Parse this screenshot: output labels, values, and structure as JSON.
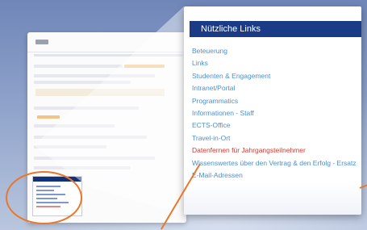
{
  "zoom_panel": {
    "title": "Nützliche Links",
    "links": [
      {
        "label": "Beteuerung"
      },
      {
        "label": "Links"
      },
      {
        "label": "Studenten & Engagement"
      },
      {
        "label": "Intranet/Portal"
      },
      {
        "label": "Programmatics"
      },
      {
        "label": "Informationen - Staff"
      },
      {
        "label": "ECTS-Office"
      },
      {
        "label": "Travel-in-Ort"
      },
      {
        "label": "Datenfernen für Jahrgangsteilnehmer"
      },
      {
        "label": "Wissenswertes über den Vertrag & den Erfolg - Ersatz"
      },
      {
        "label": "E-Mail-Adressen"
      }
    ],
    "active_index": 8
  },
  "colors": {
    "title_bar": "#1b3b86",
    "link": "#4c8fd1",
    "active_link": "#d23a2e",
    "annotation": "#e8782c"
  }
}
